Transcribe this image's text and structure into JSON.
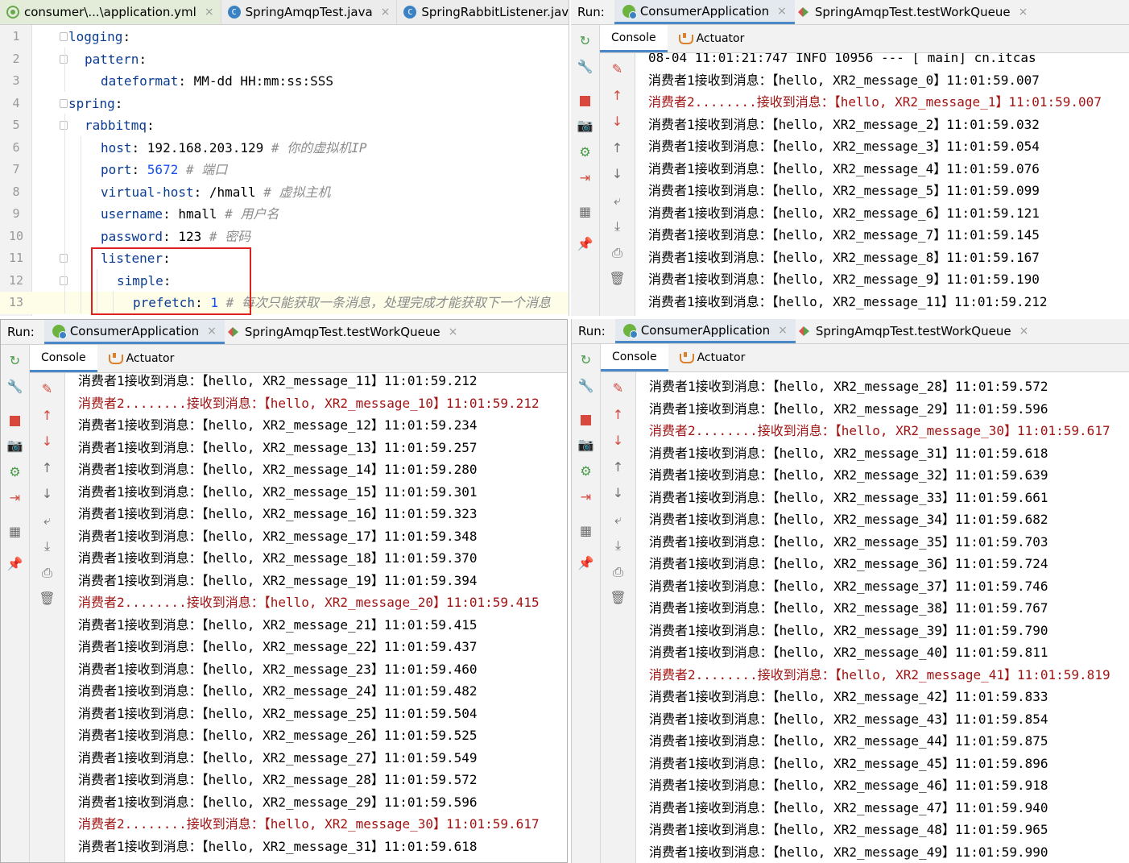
{
  "editor": {
    "tabs": [
      {
        "label": "consumer\\...\\application.yml",
        "icon": "yaml-icon",
        "close": "×"
      },
      {
        "label": "SpringAmqpTest.java",
        "icon": "java-class-icon",
        "close": "×"
      },
      {
        "label": "SpringRabbitListener.jav",
        "icon": "java-class-icon",
        "close": ""
      }
    ],
    "lines": [
      {
        "n": "1",
        "indent": 0,
        "key": "logging",
        "sep": ":",
        "value": "",
        "comment": ""
      },
      {
        "n": "2",
        "indent": 1,
        "key": "pattern",
        "sep": ":",
        "value": "",
        "comment": ""
      },
      {
        "n": "3",
        "indent": 2,
        "key": "dateformat",
        "sep": ": ",
        "value": "MM-dd HH:mm:ss:SSS",
        "comment": ""
      },
      {
        "n": "4",
        "indent": 0,
        "key": "spring",
        "sep": ":",
        "value": "",
        "comment": ""
      },
      {
        "n": "5",
        "indent": 1,
        "key": "rabbitmq",
        "sep": ":",
        "value": "",
        "comment": ""
      },
      {
        "n": "6",
        "indent": 2,
        "key": "host",
        "sep": ": ",
        "value": "192.168.203.129",
        "comment": " # 你的虚拟机IP"
      },
      {
        "n": "7",
        "indent": 2,
        "key": "port",
        "sep": ": ",
        "value": "5672",
        "num": true,
        "comment": " # 端口"
      },
      {
        "n": "8",
        "indent": 2,
        "key": "virtual-host",
        "sep": ": ",
        "value": "/hmall",
        "comment": " # 虚拟主机"
      },
      {
        "n": "9",
        "indent": 2,
        "key": "username",
        "sep": ": ",
        "value": "hmall",
        "comment": " # 用户名"
      },
      {
        "n": "10",
        "indent": 2,
        "key": "password",
        "sep": ": ",
        "value": "123",
        "comment": " # 密码"
      },
      {
        "n": "11",
        "indent": 2,
        "key": "listener",
        "sep": ":",
        "value": "",
        "comment": ""
      },
      {
        "n": "12",
        "indent": 3,
        "key": "simple",
        "sep": ":",
        "value": "",
        "comment": ""
      },
      {
        "n": "13",
        "indent": 4,
        "key": "prefetch",
        "sep": ": ",
        "value": "1",
        "num": true,
        "comment": " # 每次只能获取一条消息，处理完成才能获取下一个消息"
      }
    ]
  },
  "run_panels": {
    "run_label": "Run:",
    "tab_active": "ConsumerApplication",
    "tab_other": "SpringAmqpTest.testWorkQueue",
    "close": "×",
    "console_tab": "Console",
    "actuator_tab": "Actuator"
  },
  "console_top_right": [
    {
      "t": "log",
      "text": "08-04 11:01:21:747  INFO 10956 --- [           main] cn.itcas"
    },
    {
      "t": "c1",
      "text": "消费者1接收到消息：【hello, XR2_message_0】11:01:59.007"
    },
    {
      "t": "c2",
      "text": "消费者2........接收到消息：【hello, XR2_message_1】11:01:59.007"
    },
    {
      "t": "c1",
      "text": "消费者1接收到消息：【hello, XR2_message_2】11:01:59.032"
    },
    {
      "t": "c1",
      "text": "消费者1接收到消息：【hello, XR2_message_3】11:01:59.054"
    },
    {
      "t": "c1",
      "text": "消费者1接收到消息：【hello, XR2_message_4】11:01:59.076"
    },
    {
      "t": "c1",
      "text": "消费者1接收到消息：【hello, XR2_message_5】11:01:59.099"
    },
    {
      "t": "c1",
      "text": "消费者1接收到消息：【hello, XR2_message_6】11:01:59.121"
    },
    {
      "t": "c1",
      "text": "消费者1接收到消息：【hello, XR2_message_7】11:01:59.145"
    },
    {
      "t": "c1",
      "text": "消费者1接收到消息：【hello, XR2_message_8】11:01:59.167"
    },
    {
      "t": "c1",
      "text": "消费者1接收到消息：【hello, XR2_message_9】11:01:59.190"
    },
    {
      "t": "c1",
      "text": "消费者1接收到消息：【hello, XR2_message_11】11:01:59.212"
    }
  ],
  "console_bottom_left": [
    {
      "t": "c1",
      "text": "消费者1接收到消息：【hello, XR2_message_11】11:01:59.212"
    },
    {
      "t": "c2",
      "text": "消费者2........接收到消息：【hello, XR2_message_10】11:01:59.212"
    },
    {
      "t": "c1",
      "text": "消费者1接收到消息：【hello, XR2_message_12】11:01:59.234"
    },
    {
      "t": "c1",
      "text": "消费者1接收到消息：【hello, XR2_message_13】11:01:59.257"
    },
    {
      "t": "c1",
      "text": "消费者1接收到消息：【hello, XR2_message_14】11:01:59.280"
    },
    {
      "t": "c1",
      "text": "消费者1接收到消息：【hello, XR2_message_15】11:01:59.301"
    },
    {
      "t": "c1",
      "text": "消费者1接收到消息：【hello, XR2_message_16】11:01:59.323"
    },
    {
      "t": "c1",
      "text": "消费者1接收到消息：【hello, XR2_message_17】11:01:59.348"
    },
    {
      "t": "c1",
      "text": "消费者1接收到消息：【hello, XR2_message_18】11:01:59.370"
    },
    {
      "t": "c1",
      "text": "消费者1接收到消息：【hello, XR2_message_19】11:01:59.394"
    },
    {
      "t": "c2",
      "text": "消费者2........接收到消息：【hello, XR2_message_20】11:01:59.415"
    },
    {
      "t": "c1",
      "text": "消费者1接收到消息：【hello, XR2_message_21】11:01:59.415"
    },
    {
      "t": "c1",
      "text": "消费者1接收到消息：【hello, XR2_message_22】11:01:59.437"
    },
    {
      "t": "c1",
      "text": "消费者1接收到消息：【hello, XR2_message_23】11:01:59.460"
    },
    {
      "t": "c1",
      "text": "消费者1接收到消息：【hello, XR2_message_24】11:01:59.482"
    },
    {
      "t": "c1",
      "text": "消费者1接收到消息：【hello, XR2_message_25】11:01:59.504"
    },
    {
      "t": "c1",
      "text": "消费者1接收到消息：【hello, XR2_message_26】11:01:59.525"
    },
    {
      "t": "c1",
      "text": "消费者1接收到消息：【hello, XR2_message_27】11:01:59.549"
    },
    {
      "t": "c1",
      "text": "消费者1接收到消息：【hello, XR2_message_28】11:01:59.572"
    },
    {
      "t": "c1",
      "text": "消费者1接收到消息：【hello, XR2_message_29】11:01:59.596"
    },
    {
      "t": "c2",
      "text": "消费者2........接收到消息：【hello, XR2_message_30】11:01:59.617"
    },
    {
      "t": "c1",
      "text": "消费者1接收到消息：【hello, XR2_message_31】11:01:59.618"
    }
  ],
  "console_bottom_right": [
    {
      "t": "c1",
      "text": "消费者1接收到消息：【hello, XR2_message_28】11:01:59.572"
    },
    {
      "t": "c1",
      "text": "消费者1接收到消息：【hello, XR2_message_29】11:01:59.596"
    },
    {
      "t": "c2",
      "text": "消费者2........接收到消息：【hello, XR2_message_30】11:01:59.617"
    },
    {
      "t": "c1",
      "text": "消费者1接收到消息：【hello, XR2_message_31】11:01:59.618"
    },
    {
      "t": "c1",
      "text": "消费者1接收到消息：【hello, XR2_message_32】11:01:59.639"
    },
    {
      "t": "c1",
      "text": "消费者1接收到消息：【hello, XR2_message_33】11:01:59.661"
    },
    {
      "t": "c1",
      "text": "消费者1接收到消息：【hello, XR2_message_34】11:01:59.682"
    },
    {
      "t": "c1",
      "text": "消费者1接收到消息：【hello, XR2_message_35】11:01:59.703"
    },
    {
      "t": "c1",
      "text": "消费者1接收到消息：【hello, XR2_message_36】11:01:59.724"
    },
    {
      "t": "c1",
      "text": "消费者1接收到消息：【hello, XR2_message_37】11:01:59.746"
    },
    {
      "t": "c1",
      "text": "消费者1接收到消息：【hello, XR2_message_38】11:01:59.767"
    },
    {
      "t": "c1",
      "text": "消费者1接收到消息：【hello, XR2_message_39】11:01:59.790"
    },
    {
      "t": "c1",
      "text": "消费者1接收到消息：【hello, XR2_message_40】11:01:59.811"
    },
    {
      "t": "c2",
      "text": "消费者2........接收到消息：【hello, XR2_message_41】11:01:59.819"
    },
    {
      "t": "c1",
      "text": "消费者1接收到消息：【hello, XR2_message_42】11:01:59.833"
    },
    {
      "t": "c1",
      "text": "消费者1接收到消息：【hello, XR2_message_43】11:01:59.854"
    },
    {
      "t": "c1",
      "text": "消费者1接收到消息：【hello, XR2_message_44】11:01:59.875"
    },
    {
      "t": "c1",
      "text": "消费者1接收到消息：【hello, XR2_message_45】11:01:59.896"
    },
    {
      "t": "c1",
      "text": "消费者1接收到消息：【hello, XR2_message_46】11:01:59.918"
    },
    {
      "t": "c1",
      "text": "消费者1接收到消息：【hello, XR2_message_47】11:01:59.940"
    },
    {
      "t": "c1",
      "text": "消费者1接收到消息：【hello, XR2_message_48】11:01:59.965"
    },
    {
      "t": "c1",
      "text": "消费者1接收到消息：【hello, XR2_message_49】11:01:59.990"
    }
  ],
  "toolbar_left": [
    {
      "icon": "rerun-icon",
      "glyph": "↻"
    },
    {
      "icon": "wrench-icon",
      "glyph": "🔧"
    },
    {
      "icon": "stop-icon",
      "glyph": ""
    },
    {
      "icon": "camera-icon",
      "glyph": "📷"
    },
    {
      "icon": "debug-icon",
      "glyph": "⚙"
    },
    {
      "icon": "exit-icon",
      "glyph": "⇥"
    },
    {
      "icon": "layout-icon",
      "glyph": "▦"
    },
    {
      "icon": "pin-icon",
      "glyph": "📌"
    }
  ],
  "toolbar_right": [
    {
      "icon": "clear-icon",
      "glyph": "✎"
    },
    {
      "icon": "up-red-icon",
      "glyph": "↑"
    },
    {
      "icon": "down-red-icon",
      "glyph": "↓"
    },
    {
      "icon": "up-arrow-icon",
      "glyph": "↑"
    },
    {
      "icon": "down-arrow-icon",
      "glyph": "↓"
    },
    {
      "icon": "soft-wrap-icon",
      "glyph": "⤶"
    },
    {
      "icon": "scroll-to-end-icon",
      "glyph": "⤓"
    },
    {
      "icon": "print-icon",
      "glyph": "⎙"
    },
    {
      "icon": "trash-icon",
      "glyph": "🗑"
    }
  ],
  "colors": {
    "consumer2_text": "#a11414",
    "yaml_key": "#0b3c91",
    "number": "#1750eb",
    "comment": "#8c8c8c",
    "highlight_box": "#e02020",
    "active_tab_underline": "#4a88c7"
  }
}
